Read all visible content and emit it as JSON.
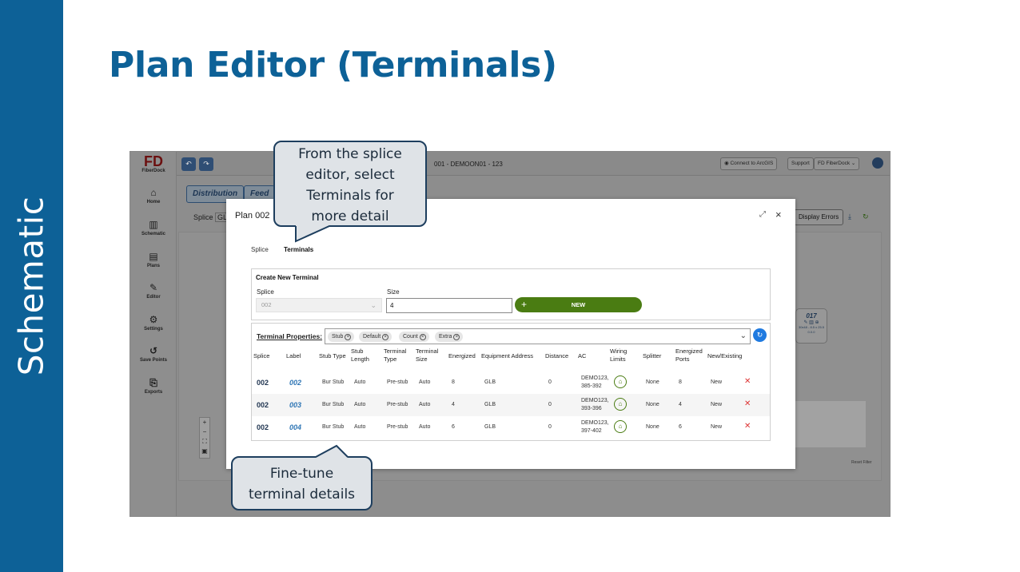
{
  "slide": {
    "side_label": "Schematic",
    "title": "Plan Editor (Terminals)"
  },
  "app": {
    "logo_text": "FiberDock",
    "window_title": "001 - DEMOON01 - 123",
    "topbar": {
      "connect_label": "Connect to ArcGIS",
      "support_label": "Support",
      "account_label": "FiberDock"
    },
    "nav": [
      {
        "label": "Home",
        "icon": "home-icon"
      },
      {
        "label": "Schematic",
        "icon": "map-icon"
      },
      {
        "label": "Plans",
        "icon": "document-icon"
      },
      {
        "label": "Editor",
        "icon": "pencil-icon"
      },
      {
        "label": "Settings",
        "icon": "gear-icon"
      },
      {
        "label": "Save Points",
        "icon": "history-icon"
      },
      {
        "label": "Exports",
        "icon": "export-icon"
      }
    ],
    "bg_tabs": [
      "Distribution",
      "Feed"
    ],
    "splice_label": "Splice",
    "splice_value": "GL",
    "display_errors_label": "Display Errors",
    "bg_node": {
      "label": "017",
      "line1": "30x48 - 8.5 x 25.5",
      "line2": "0.0.0"
    },
    "reset_label": "Reset Filter"
  },
  "modal": {
    "title": "Plan 002",
    "tabs": [
      "Splice",
      "Terminals"
    ],
    "active_tab": "Terminals",
    "create": {
      "heading": "Create New Terminal",
      "splice_label": "Splice",
      "splice_value": "002",
      "size_label": "Size",
      "size_value": "4",
      "new_label": "NEW"
    },
    "properties": {
      "label": "Terminal Properties:",
      "chips": [
        "Stub",
        "Default",
        "Count",
        "Extra"
      ]
    },
    "columns": [
      "Splice",
      "Label",
      "Stub Type",
      "Stub Length",
      "Terminal Type",
      "Terminal Size",
      "Energized",
      "Equipment Address",
      "Distance",
      "AC",
      "Wiring Limits",
      "Splitter",
      "Energized Ports",
      "New/Existing"
    ],
    "rows": [
      {
        "splice": "002",
        "label": "002",
        "stub_type": "Bur Stub",
        "stub_length": "Auto",
        "terminal_type": "Pre-stub",
        "terminal_size": "Auto",
        "energized": "8",
        "equipment_address": "GLB",
        "distance": "0",
        "ac_line1": "DEMO123,",
        "ac_line2": "385-392",
        "splitter": "None",
        "energized_ports": "8",
        "new_existing": "New"
      },
      {
        "splice": "002",
        "label": "003",
        "stub_type": "Bur Stub",
        "stub_length": "Auto",
        "terminal_type": "Pre-stub",
        "terminal_size": "Auto",
        "energized": "4",
        "equipment_address": "GLB",
        "distance": "0",
        "ac_line1": "DEMO123,",
        "ac_line2": "393-396",
        "splitter": "None",
        "energized_ports": "4",
        "new_existing": "New"
      },
      {
        "splice": "002",
        "label": "004",
        "stub_type": "Bur Stub",
        "stub_length": "Auto",
        "terminal_type": "Pre-stub",
        "terminal_size": "Auto",
        "energized": "6",
        "equipment_address": "GLB",
        "distance": "0",
        "ac_line1": "DEMO123,",
        "ac_line2": "397-402",
        "splitter": "None",
        "energized_ports": "6",
        "new_existing": "New"
      }
    ]
  },
  "callouts": {
    "top": [
      "From the splice",
      "editor, select",
      "Terminals for",
      "more detail"
    ],
    "bottom": [
      "Fine-tune",
      "terminal details"
    ]
  },
  "colors": {
    "brand_blue": "#0d6197",
    "new_button_green": "#4a7c12",
    "refresh_blue": "#1f7ae0",
    "delete_red": "#dd3333"
  }
}
